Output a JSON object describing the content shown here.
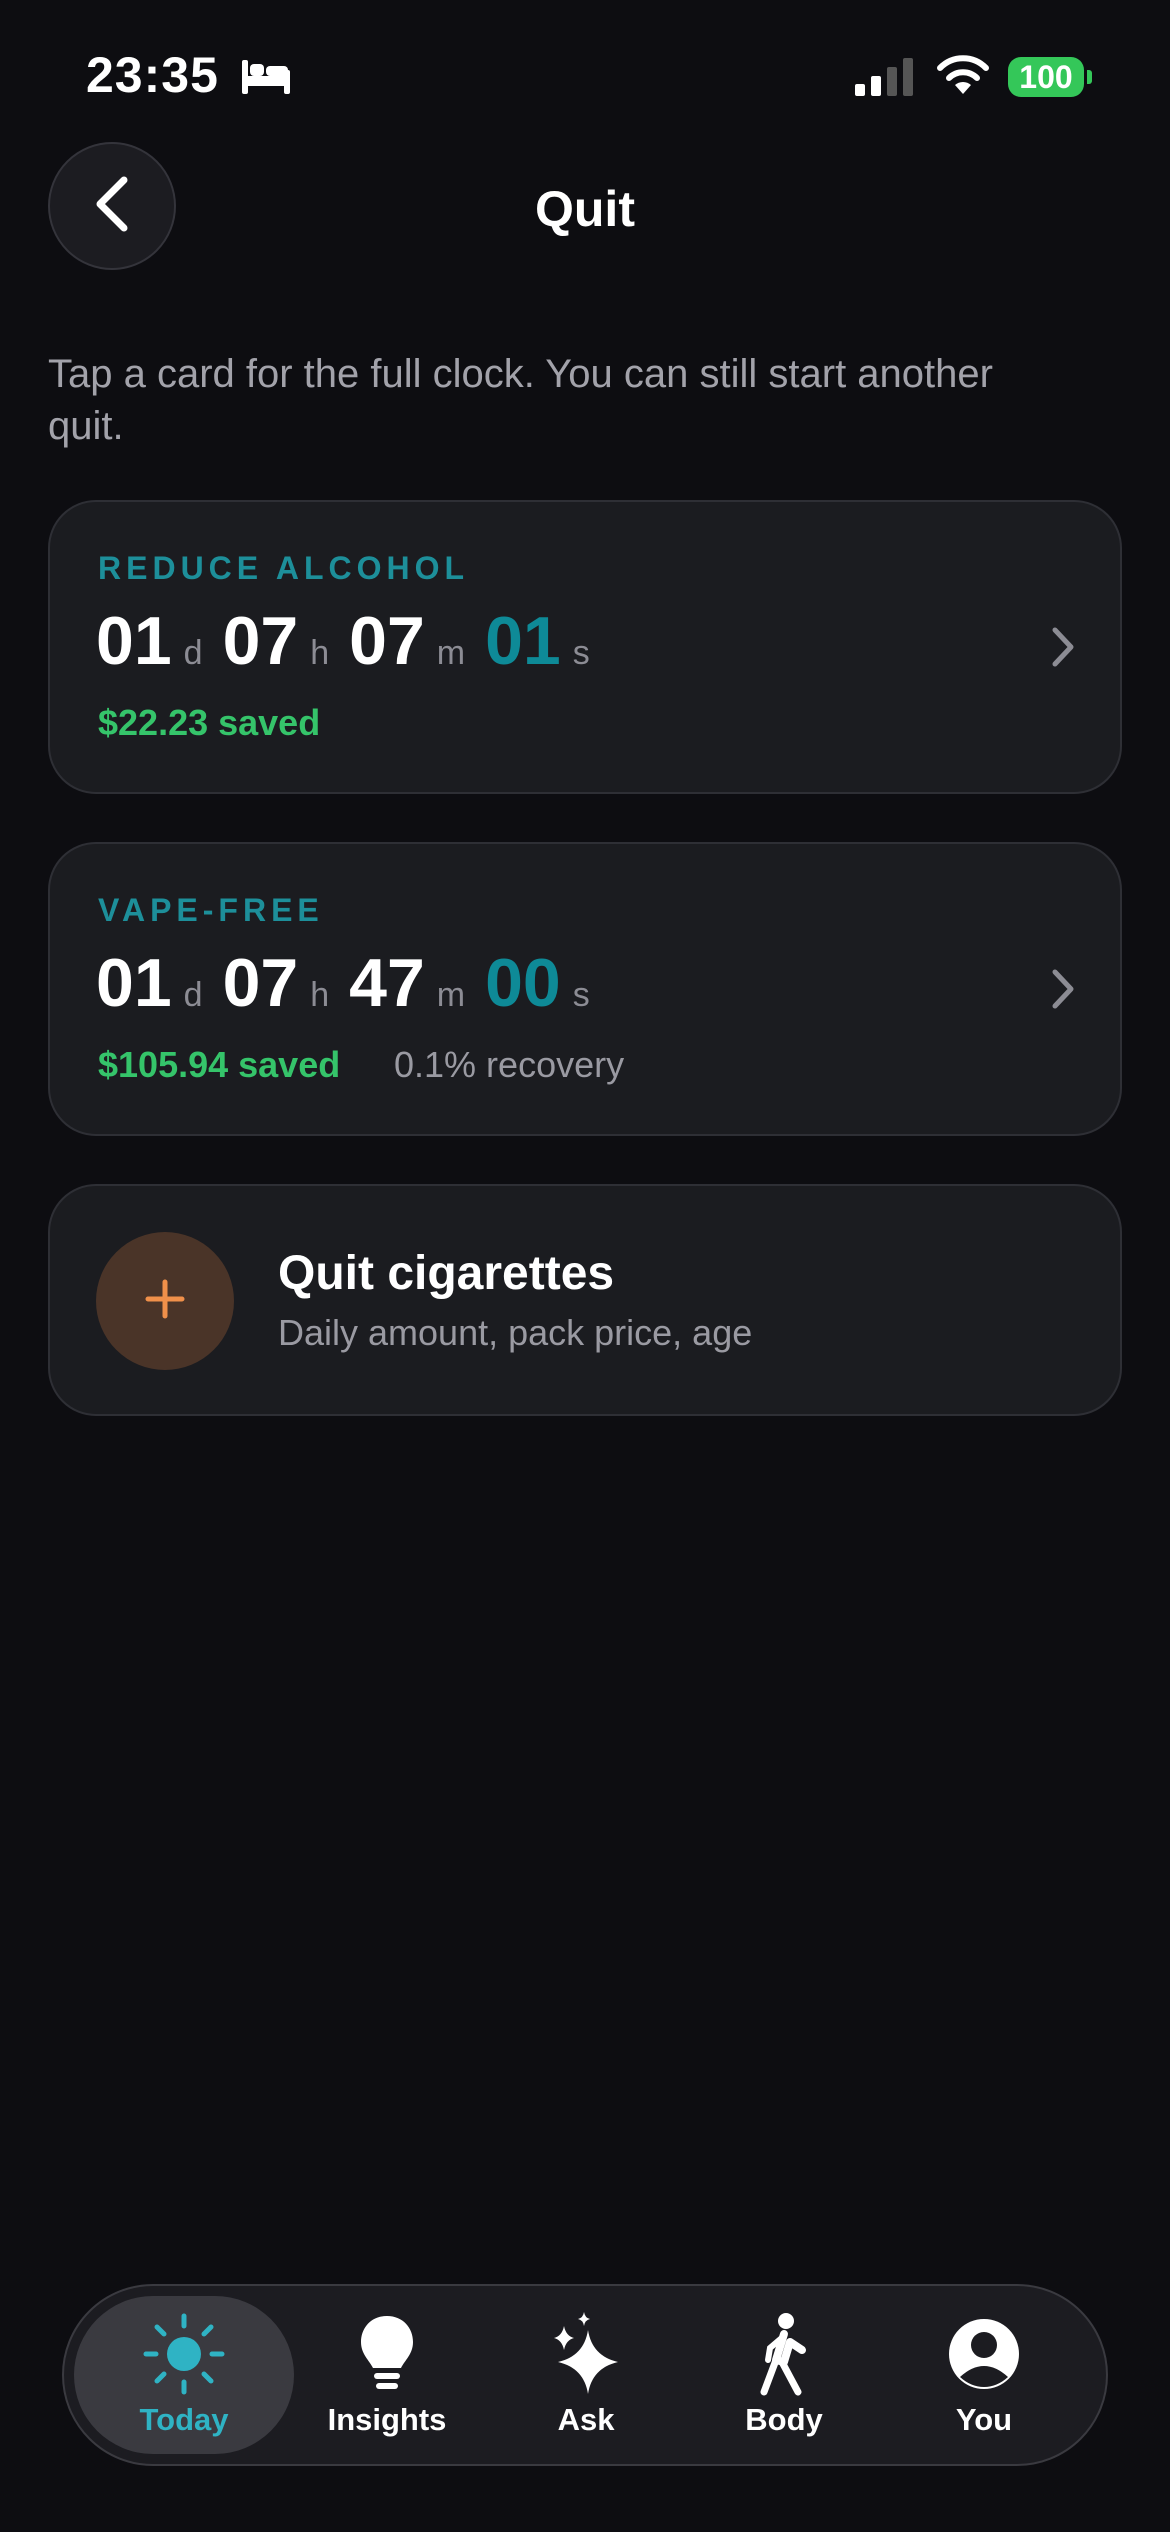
{
  "status_bar": {
    "time": "23:35",
    "battery": "100"
  },
  "header": {
    "title": "Quit"
  },
  "subtitle": "Tap a card for the full clock. You can still start another quit.",
  "quits": [
    {
      "label": "REDUCE ALCOHOL",
      "days": "01",
      "hours": "07",
      "minutes": "07",
      "seconds": "01",
      "saved": "$22.23 saved",
      "recovery": ""
    },
    {
      "label": "VAPE-FREE",
      "days": "01",
      "hours": "07",
      "minutes": "47",
      "seconds": "00",
      "saved": "$105.94 saved",
      "recovery": "0.1% recovery"
    }
  ],
  "units": {
    "d": "d",
    "h": "h",
    "m": "m",
    "s": "s"
  },
  "add_quit": {
    "title": "Quit cigarettes",
    "subtitle": "Daily amount, pack price, age"
  },
  "tabs": [
    {
      "label": "Today",
      "icon": "sun-icon",
      "active": true
    },
    {
      "label": "Insights",
      "icon": "lightbulb-icon",
      "active": false
    },
    {
      "label": "Ask",
      "icon": "sparkles-icon",
      "active": false
    },
    {
      "label": "Body",
      "icon": "walking-figure-icon",
      "active": false
    },
    {
      "label": "You",
      "icon": "person-circle-icon",
      "active": false
    }
  ],
  "colors": {
    "background": "#0d0d11",
    "card": "#1b1c20",
    "label_teal": "#1d8f9a",
    "seconds_teal": "#0e8a97",
    "saved_green": "#35c46a",
    "accent_orange": "#f0904a",
    "active_tab": "#2fb3c4",
    "battery_green": "#34c759"
  }
}
